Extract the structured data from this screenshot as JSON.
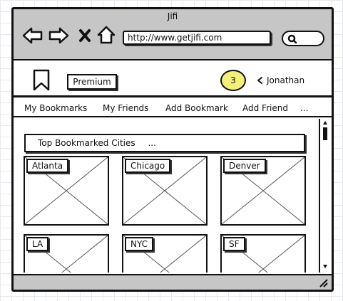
{
  "window": {
    "title": "Jifi"
  },
  "browser": {
    "url": "http://www.getjifi.com"
  },
  "header": {
    "premium_label": "Premium",
    "notification_count": "3",
    "user_name": "Jonathan"
  },
  "nav": {
    "items": [
      "My Bookmarks",
      "My Friends",
      "Add Bookmark",
      "Add Friend",
      "..."
    ]
  },
  "section": {
    "title": "Top Bookmarked Cities",
    "more": "..."
  },
  "cities": [
    "Atlanta",
    "Chicago",
    "Denver",
    "LA",
    "NYC",
    "SF"
  ]
}
